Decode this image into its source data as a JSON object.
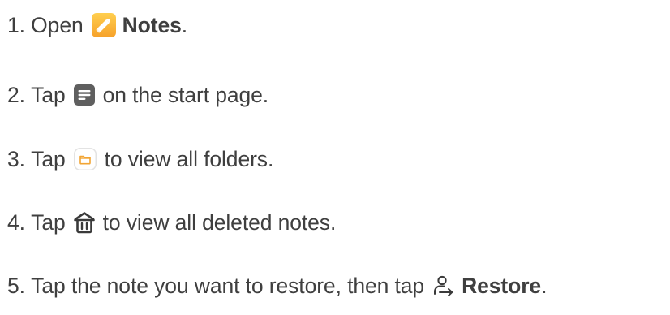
{
  "steps": [
    {
      "number": "1.",
      "text_before": "Open",
      "icon": "notes-app-icon",
      "bold": "Notes",
      "text_after": "."
    },
    {
      "number": "2.",
      "text_before": "Tap",
      "icon": "notes-list-icon",
      "text_after": "on the start page."
    },
    {
      "number": "3.",
      "text_before": "Tap",
      "icon": "folder-icon",
      "text_after": "to view all folders."
    },
    {
      "number": "4.",
      "text_before": "Tap",
      "icon": "trash-icon",
      "text_after": "to view all deleted notes."
    },
    {
      "number": "5.",
      "text_before": "Tap the note you want to restore, then tap",
      "icon": "restore-icon",
      "bold": "Restore",
      "text_after": "."
    }
  ],
  "colors": {
    "text": "#3f3f3f",
    "notes_gradient_top": "#ffc94a",
    "notes_gradient_bottom": "#f7a52c",
    "icon_gray": "#666666",
    "folder_orange": "#f5a623",
    "folder_border": "#e8e8e8"
  }
}
